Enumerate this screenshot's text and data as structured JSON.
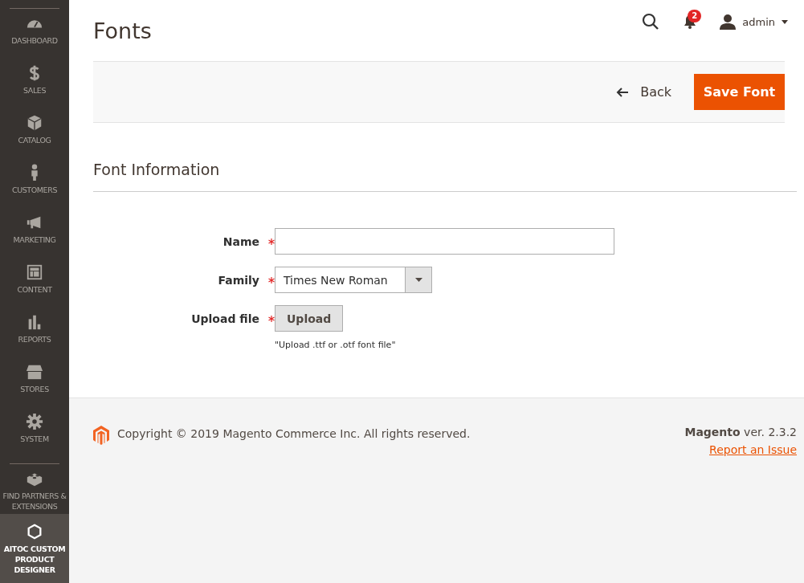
{
  "sidebar": {
    "items": [
      {
        "label": "DASHBOARD",
        "selected": false
      },
      {
        "label": "SALES",
        "selected": false
      },
      {
        "label": "CATALOG",
        "selected": false
      },
      {
        "label": "CUSTOMERS",
        "selected": false
      },
      {
        "label": "MARKETING",
        "selected": false
      },
      {
        "label": "CONTENT",
        "selected": false
      },
      {
        "label": "REPORTS",
        "selected": false
      },
      {
        "label": "STORES",
        "selected": false
      },
      {
        "label": "SYSTEM",
        "selected": false
      }
    ],
    "extra_items": [
      {
        "label": "FIND PARTNERS & EXTENSIONS",
        "selected": false
      },
      {
        "label": "AITOC CUSTOM PRODUCT DESIGNER",
        "selected": true
      }
    ]
  },
  "header": {
    "title": "Fonts",
    "notifications": "2",
    "user": "admin"
  },
  "actions": {
    "back": "Back",
    "save": "Save Font"
  },
  "section": {
    "title": "Font Information"
  },
  "form": {
    "fields": [
      {
        "kind": "text",
        "label": "Name",
        "required": true
      },
      {
        "kind": "select",
        "label": "Family",
        "required": true,
        "value": "Times New Roman"
      },
      {
        "kind": "upload",
        "label": "Upload file",
        "required": true,
        "button": "Upload",
        "note": "\"Upload .ttf or .otf font file\""
      }
    ]
  },
  "footer": {
    "copyright": "Copyright © 2019 Magento Commerce Inc. All rights reserved.",
    "version": "**Magento** ver. 2.3.2",
    "report_link": "Report an Issue"
  }
}
